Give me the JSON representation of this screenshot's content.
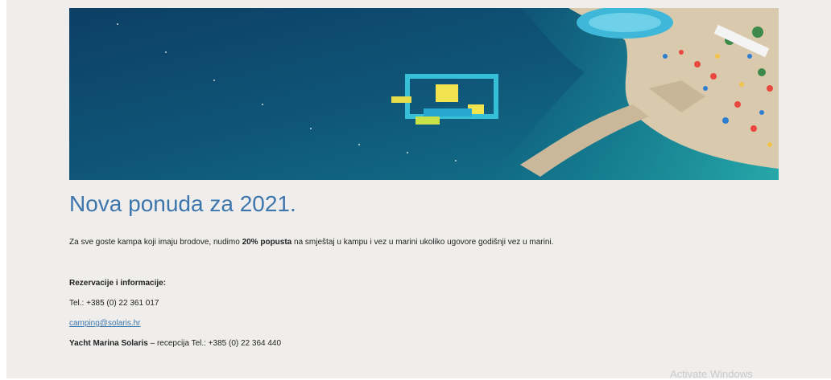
{
  "hero": {
    "alt_icon": "beach-aqua-park-photo"
  },
  "headline": "Nova ponuda za 2021.",
  "intro": {
    "before": "Za sve goste kampa koji imaju brodove, nudimo ",
    "bold": "20% popusta",
    "after": " na smještaj u kampu i vez u marini ukoliko ugovore godišnji vez u marini."
  },
  "reservations": {
    "heading": "Rezervacije i informacije:",
    "phone": "Tel.: +385 (0) 22 361 017",
    "email": "camping@solaris.hr",
    "marina_bold": "Yacht Marina Solaris",
    "marina_rest": " – recepcija Tel.: +385 (0) 22 364 440"
  },
  "watermark": "Activate Windows"
}
